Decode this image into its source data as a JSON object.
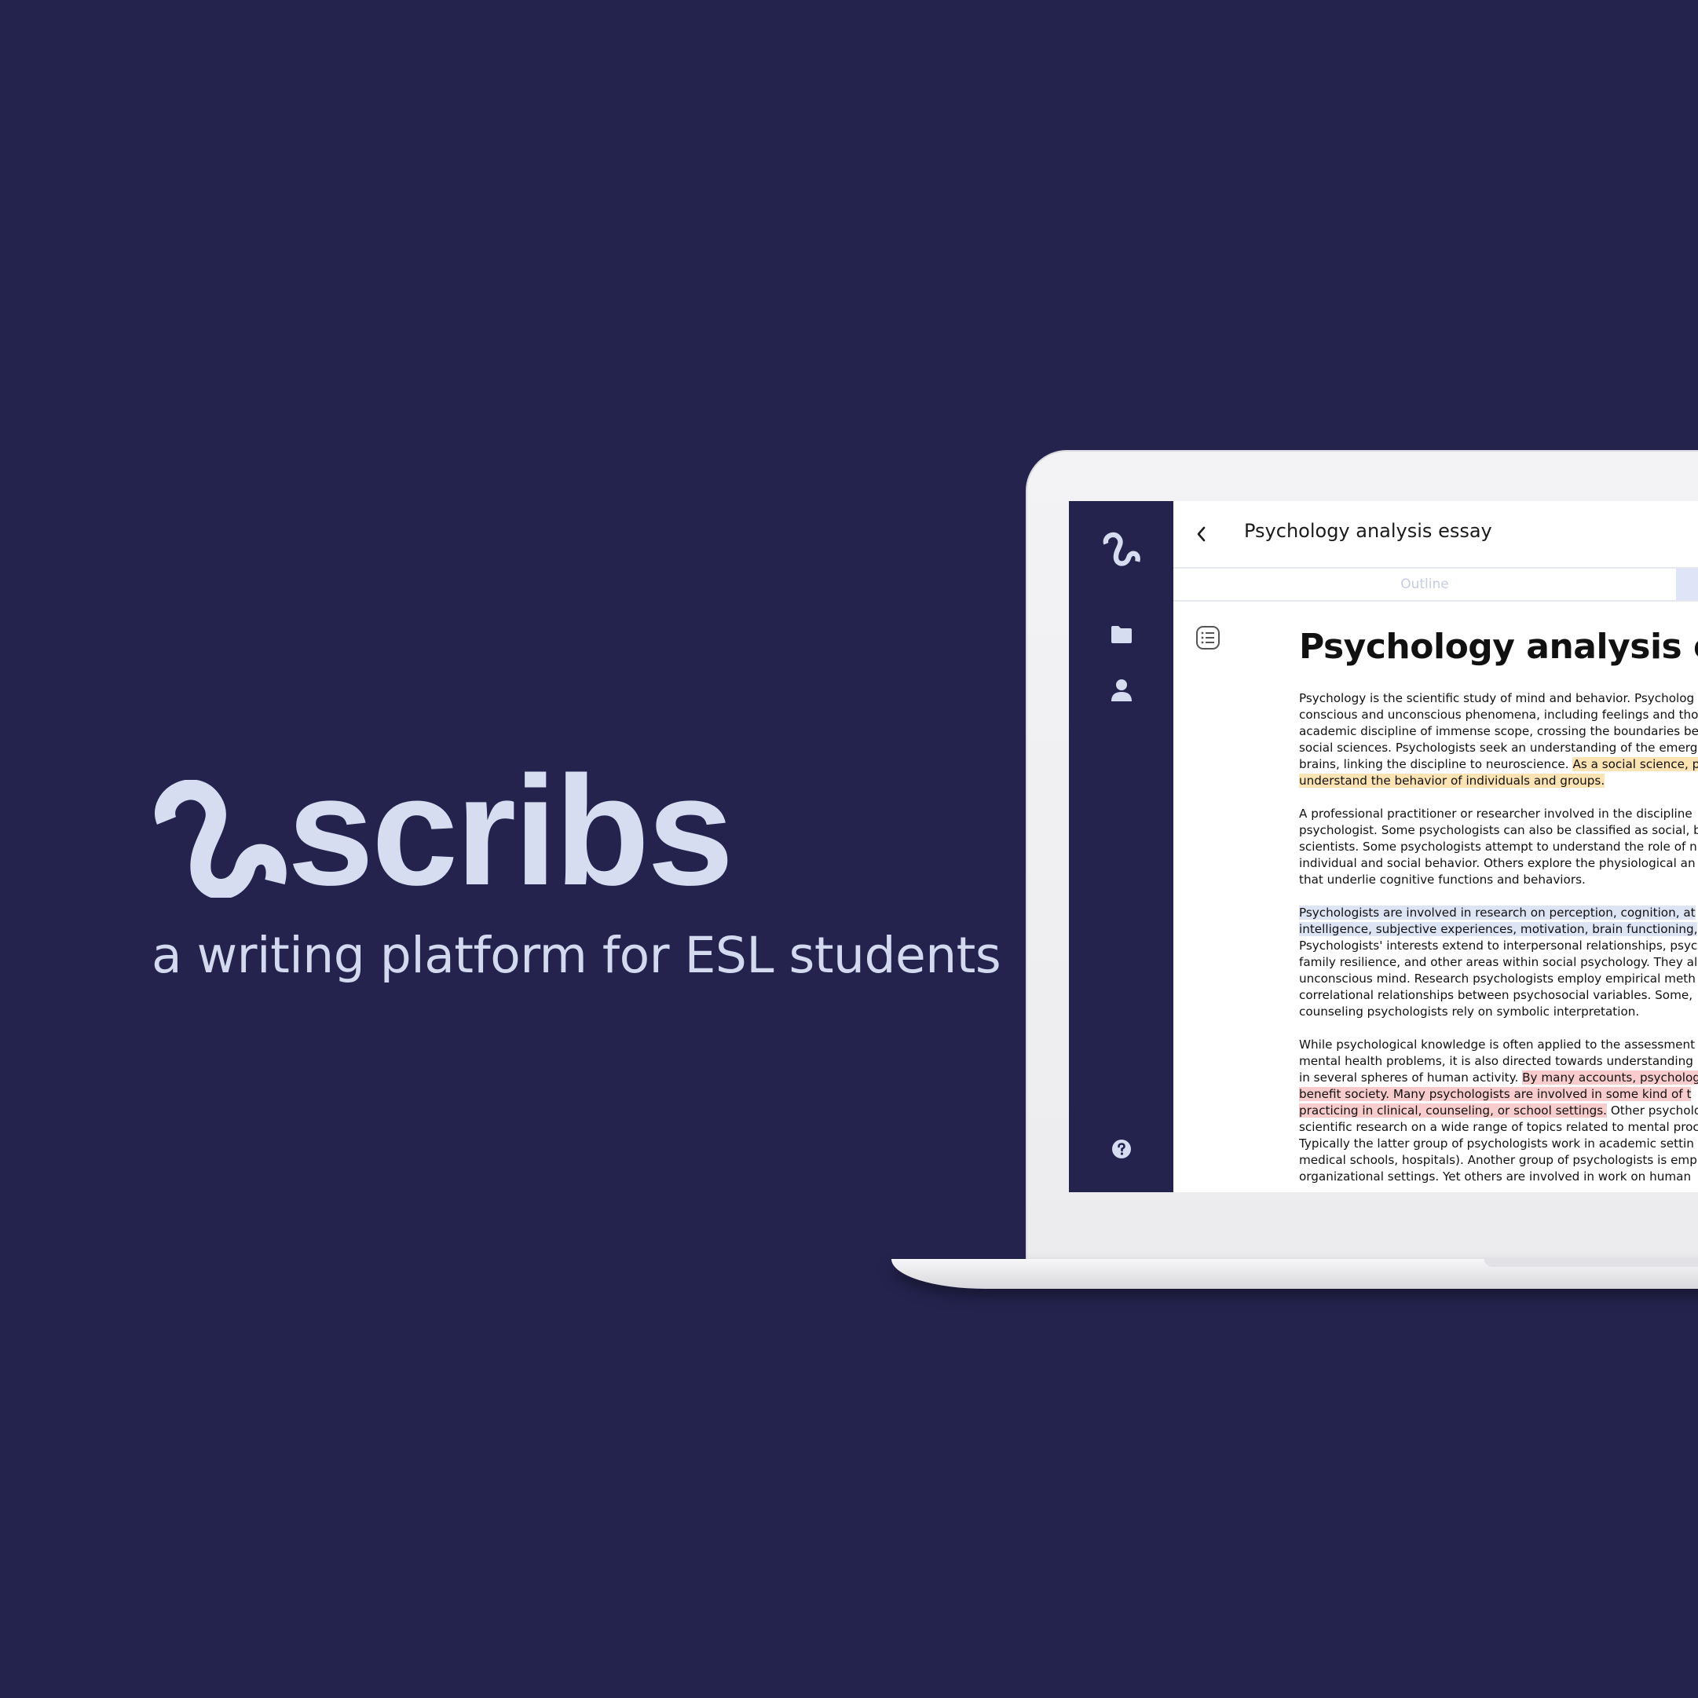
{
  "brand": {
    "name": "scribs",
    "tagline": "a writing platform for ESL students",
    "logo_icon": "scribs-squiggle-logo",
    "colors": {
      "background": "#24234e",
      "brand_text": "#d6ddf1"
    }
  },
  "app": {
    "sidebar": {
      "logo_icon": "scribs-squiggle-icon",
      "items": [
        {
          "icon": "folder-icon"
        },
        {
          "icon": "user-icon"
        }
      ],
      "help_icon": "help-circle-icon"
    },
    "header": {
      "back_icon": "chevron-left-icon",
      "title": "Psychology analysis essay"
    },
    "tabs": [
      {
        "label": "Outline",
        "active": false
      },
      {
        "label": "",
        "active": true
      }
    ],
    "toc_icon": "list-icon",
    "essay": {
      "heading": "Psychology analysis essa",
      "paragraphs": [
        {
          "lines": [
            [
              {
                "text": "Psychology is the scientific study of mind and behavior. Psycholog",
                "hl": ""
              }
            ],
            [
              {
                "text": "conscious and unconscious phenomena, including feelings and tho",
                "hl": ""
              }
            ],
            [
              {
                "text": "academic discipline of immense scope, crossing the boundaries be",
                "hl": ""
              }
            ],
            [
              {
                "text": "social sciences. Psychologists seek an understanding of the emerg",
                "hl": ""
              }
            ],
            [
              {
                "text": "brains, linking the discipline to neuroscience. ",
                "hl": ""
              },
              {
                "text": "As a social science, p",
                "hl": "yellow"
              }
            ],
            [
              {
                "text": "understand the behavior of individuals and groups.",
                "hl": "yellow"
              }
            ]
          ]
        },
        {
          "lines": [
            [
              {
                "text": "A professional practitioner or researcher involved in the discipline",
                "hl": ""
              }
            ],
            [
              {
                "text": "psychologist. Some psychologists can also be classified as social, b",
                "hl": ""
              }
            ],
            [
              {
                "text": "scientists. Some psychologists attempt to understand the role of n",
                "hl": ""
              }
            ],
            [
              {
                "text": "individual and social behavior. Others explore the physiological an",
                "hl": ""
              }
            ],
            [
              {
                "text": "that underlie cognitive functions and behaviors.",
                "hl": ""
              }
            ]
          ]
        },
        {
          "lines": [
            [
              {
                "text": "Psychologists are involved in research on perception, cognition, at",
                "hl": "blue"
              }
            ],
            [
              {
                "text": "intelligence, subjective experiences, motivation, brain functioning,",
                "hl": "blue"
              }
            ],
            [
              {
                "text": "Psychologists' interests extend to interpersonal relationships, psyc",
                "hl": ""
              }
            ],
            [
              {
                "text": "family resilience, and other areas within social psychology. They al",
                "hl": ""
              }
            ],
            [
              {
                "text": "unconscious mind. Research psychologists employ empirical meth",
                "hl": ""
              }
            ],
            [
              {
                "text": "correlational relationships between psychosocial variables. Some, ",
                "hl": ""
              }
            ],
            [
              {
                "text": "counseling psychologists rely on symbolic interpretation.",
                "hl": ""
              }
            ]
          ]
        },
        {
          "lines": [
            [
              {
                "text": "While psychological knowledge is often applied to the assessment",
                "hl": ""
              }
            ],
            [
              {
                "text": "mental health problems, it is also directed towards understanding ",
                "hl": ""
              }
            ],
            [
              {
                "text": "in several spheres of human activity. ",
                "hl": ""
              },
              {
                "text": "By many accounts, psycholog",
                "hl": "red"
              }
            ],
            [
              {
                "text": "benefit society. Many psychologists are involved in some kind of t",
                "hl": "red"
              }
            ],
            [
              {
                "text": "practicing in clinical, counseling, or school settings.",
                "hl": "red"
              },
              {
                "text": " Other psycholo",
                "hl": ""
              }
            ],
            [
              {
                "text": "scientific research on a wide range of topics related to mental proc",
                "hl": ""
              }
            ],
            [
              {
                "text": "Typically the latter group of psychologists work in academic settin",
                "hl": ""
              }
            ],
            [
              {
                "text": "medical schools, hospitals). Another group of psychologists is emp",
                "hl": ""
              }
            ],
            [
              {
                "text": "organizational settings. Yet others are involved in work on human ",
                "hl": ""
              }
            ]
          ]
        }
      ]
    }
  }
}
